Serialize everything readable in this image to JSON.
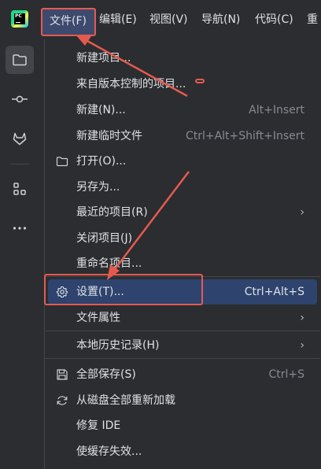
{
  "menubar": {
    "logo_text": "PC",
    "menus": [
      {
        "label": "文件(F)"
      },
      {
        "label": "编辑(E)"
      },
      {
        "label": "视图(V)"
      },
      {
        "label": "导航(N)"
      },
      {
        "label": "代码(C)"
      },
      {
        "label": "重"
      }
    ]
  },
  "sidebar": {
    "items": [
      {
        "icon": "folder-icon"
      },
      {
        "icon": "commit-icon"
      },
      {
        "icon": "gitlab-icon"
      },
      {
        "icon": "structure-icon"
      },
      {
        "icon": "more-icon"
      }
    ]
  },
  "file_menu": {
    "items": [
      {
        "label": "新建项目..."
      },
      {
        "label": "来自版本控制的项目..."
      },
      {
        "label": "新建(N)...",
        "shortcut": "Alt+Insert"
      },
      {
        "label": "新建临时文件",
        "shortcut": "Ctrl+Alt+Shift+Insert"
      },
      {
        "label": "打开(O)...",
        "icon": "folder-icon"
      },
      {
        "label": "另存为..."
      },
      {
        "label": "最近的项目(R)",
        "submenu": true
      },
      {
        "label": "关闭项目(J)"
      },
      {
        "label": "重命名项目..."
      },
      {
        "label": "设置(T)...",
        "shortcut": "Ctrl+Alt+S",
        "icon": "gear-icon",
        "highlighted": true
      },
      {
        "label": "文件属性",
        "submenu": true
      },
      {
        "label": "本地历史记录(H)",
        "submenu": true
      },
      {
        "label": "全部保存(S)",
        "shortcut": "Ctrl+S",
        "icon": "save-icon"
      },
      {
        "label": "从磁盘全部重新加载",
        "icon": "reload-icon"
      },
      {
        "label": "修复 IDE"
      },
      {
        "label": "使缓存失效..."
      }
    ]
  },
  "colors": {
    "background": "#2b2d30",
    "highlight": "#2e436e",
    "annotation": "#e55a4f",
    "text": "#dfe1e5",
    "shortcut_text": "#868a91"
  }
}
